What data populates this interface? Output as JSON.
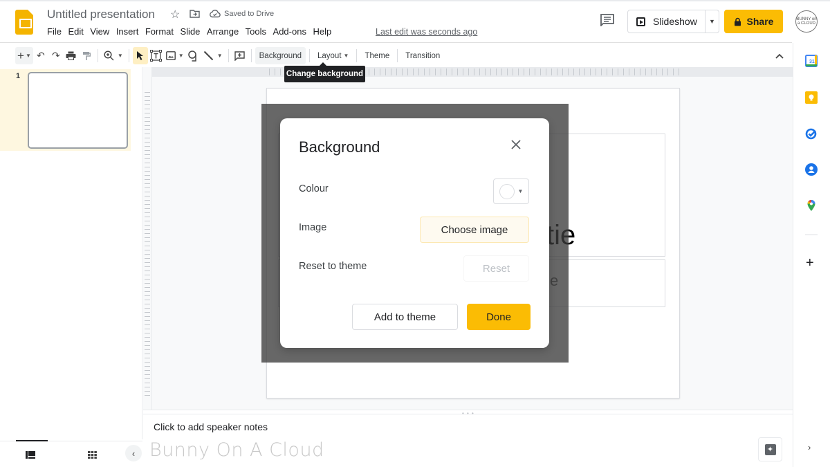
{
  "header": {
    "doc_title": "Untitled presentation",
    "saved_status": "Saved to Drive",
    "menu": [
      "File",
      "Edit",
      "View",
      "Insert",
      "Format",
      "Slide",
      "Arrange",
      "Tools",
      "Add-ons",
      "Help"
    ],
    "last_edit": "Last edit was seconds ago",
    "slideshow_label": "Slideshow",
    "share_label": "Share",
    "avatar_text": "BUNNY on a CLOUD",
    "icons": {
      "star": "star-icon",
      "move": "move-to-folder-icon",
      "cloud": "cloud-saved-icon",
      "comments": "comment-history-icon"
    }
  },
  "toolbar": {
    "background_label": "Background",
    "layout_label": "Layout",
    "theme_label": "Theme",
    "transition_label": "Transition",
    "tooltip": "Change background"
  },
  "filmstrip": {
    "slides": [
      {
        "number": "1",
        "selected": true
      }
    ]
  },
  "slide": {
    "title_fragment": "tie",
    "subtitle_fragment": "e"
  },
  "dialog": {
    "title": "Background",
    "colour_label": "Colour",
    "colour_value": "#ffffff",
    "image_label": "Image",
    "choose_image_label": "Choose image",
    "reset_label_row": "Reset to theme",
    "reset_button": "Reset",
    "add_to_theme_label": "Add to theme",
    "done_label": "Done"
  },
  "notes": {
    "placeholder": "Click to add speaker notes",
    "watermark": "Bunny On A Cloud"
  },
  "colors": {
    "accent": "#fbbc04",
    "selection_bg": "#fef7e0"
  }
}
